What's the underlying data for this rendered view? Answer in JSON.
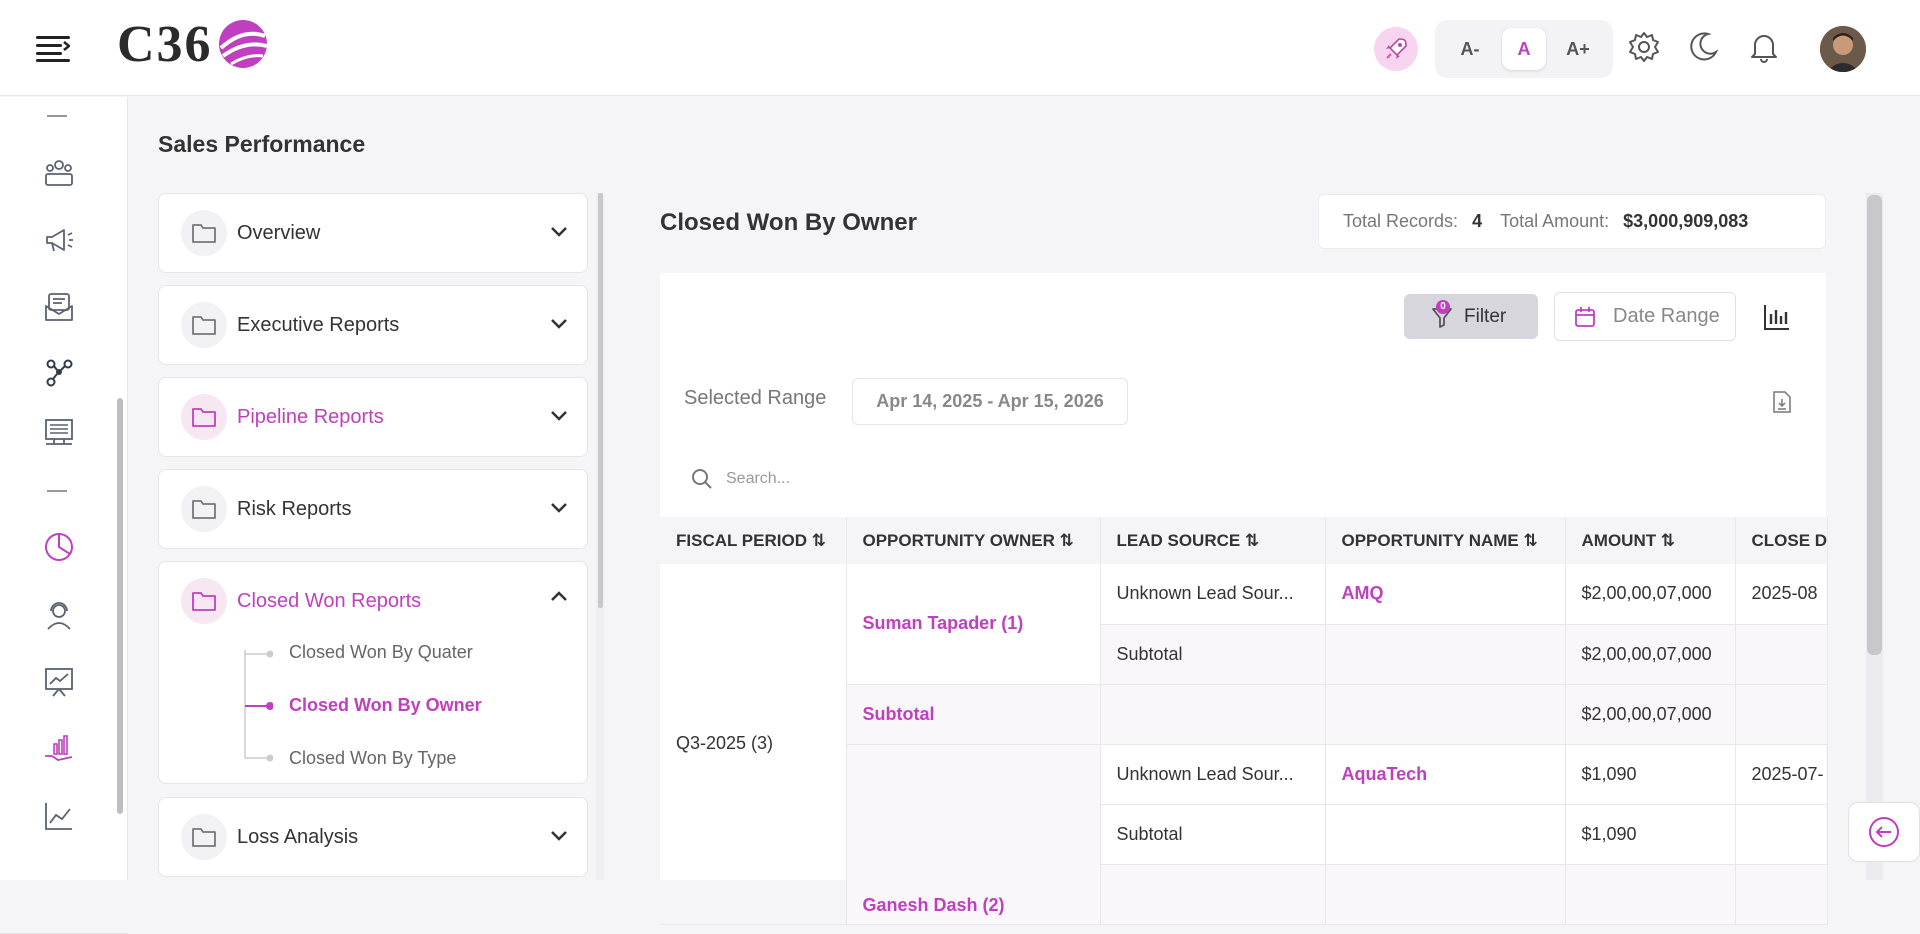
{
  "header": {
    "logo_text": "C36",
    "font_buttons": [
      "A-",
      "A",
      "A+"
    ],
    "icons": [
      "menu-icon",
      "rocket-icon",
      "settings-icon",
      "moon-icon",
      "bell-icon"
    ],
    "accent": "#c03fc0"
  },
  "page": {
    "title": "Sales Performance"
  },
  "nav": {
    "sections": [
      {
        "label": "Overview",
        "expanded": false,
        "highlight": false
      },
      {
        "label": "Executive Reports",
        "expanded": false,
        "highlight": false
      },
      {
        "label": "Pipeline Reports",
        "expanded": false,
        "highlight": true
      },
      {
        "label": "Risk Reports",
        "expanded": false,
        "highlight": false
      },
      {
        "label": "Closed Won Reports",
        "expanded": true,
        "highlight": true,
        "items": [
          {
            "label": "Closed Won By Quater",
            "active": false
          },
          {
            "label": "Closed Won By Owner",
            "active": true
          },
          {
            "label": "Closed Won By Type",
            "active": false
          }
        ]
      },
      {
        "label": "Loss Analysis",
        "expanded": false,
        "highlight": false
      }
    ]
  },
  "report": {
    "title": "Closed Won By Owner",
    "total_records_label": "Total Records:",
    "total_records": "4",
    "total_amount_label": "Total Amount:",
    "total_amount": "$3,000,909,083",
    "filter_label": "Filter",
    "filter_count": "0",
    "date_range_label": "Date Range",
    "selected_range_label": "Selected Range",
    "selected_range": "Apr 14, 2025 - Apr 15, 2026",
    "search_placeholder": "Search..."
  },
  "table": {
    "columns": [
      "FISCAL PERIOD",
      "OPPORTUNITY OWNER",
      "LEAD SOURCE",
      "OPPORTUNITY NAME",
      "AMOUNT",
      "CLOSE D"
    ],
    "fiscal_period": "Q3-2025 (3)",
    "rows": [
      {
        "owner": "Suman Tapader (1)",
        "lead": "Unknown Lead Sour...",
        "opp": "AMQ",
        "amount": "$2,00,00,07,000",
        "close": "2025-08"
      },
      {
        "lead": "Subtotal",
        "amount": "$2,00,00,07,000"
      },
      {
        "owner": "Subtotal",
        "amount": "$2,00,00,07,000"
      },
      {
        "lead": "Unknown Lead Sour...",
        "opp": "AquaTech",
        "amount": "$1,090",
        "close": "2025-07-"
      },
      {
        "lead": "Subtotal",
        "amount": "$1,090"
      },
      {
        "owner": "Ganesh Dash (2)"
      }
    ]
  }
}
